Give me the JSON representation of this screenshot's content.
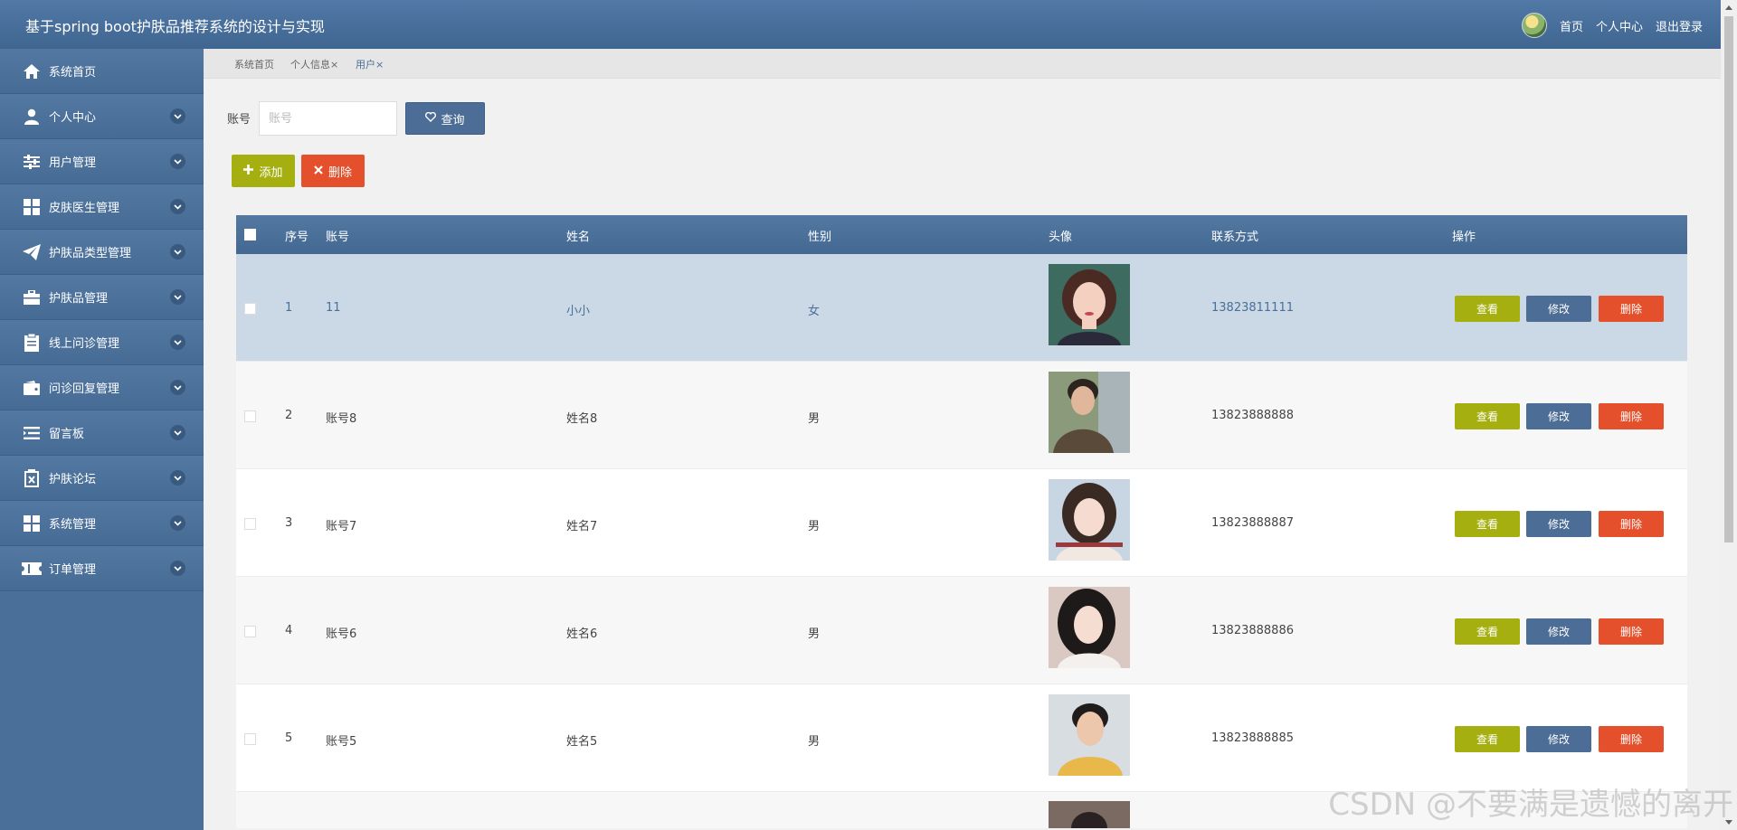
{
  "header": {
    "title": "基于spring boot护肤品推荐系统的设计与实现",
    "links": [
      "首页",
      "个人中心",
      "退出登录"
    ]
  },
  "sidebar": {
    "items": [
      {
        "label": "系统首页",
        "icon": "home-icon",
        "expandable": false
      },
      {
        "label": "个人中心",
        "icon": "user-icon",
        "expandable": true
      },
      {
        "label": "用户管理",
        "icon": "sliders-icon",
        "expandable": true
      },
      {
        "label": "皮肤医生管理",
        "icon": "grid-icon",
        "expandable": true
      },
      {
        "label": "护肤品类型管理",
        "icon": "paper-plane-icon",
        "expandable": true
      },
      {
        "label": "护肤品管理",
        "icon": "briefcase-icon",
        "expandable": true
      },
      {
        "label": "线上问诊管理",
        "icon": "clipboard-icon",
        "expandable": true
      },
      {
        "label": "问诊回复管理",
        "icon": "wallet-icon",
        "expandable": true
      },
      {
        "label": "留言板",
        "icon": "list-indent-icon",
        "expandable": true
      },
      {
        "label": "护肤论坛",
        "icon": "clipboard-x-icon",
        "expandable": true
      },
      {
        "label": "系统管理",
        "icon": "grid-icon",
        "expandable": true
      },
      {
        "label": "订单管理",
        "icon": "ticket-icon",
        "expandable": true
      }
    ]
  },
  "breadcrumb": {
    "tabs": [
      "系统首页",
      "个人信息×",
      "用户×"
    ]
  },
  "search": {
    "label": "账号",
    "placeholder": "账号",
    "button_label": "查询"
  },
  "actions": {
    "add_label": "添加",
    "delete_label": "删除"
  },
  "table": {
    "columns": [
      "序号",
      "账号",
      "姓名",
      "性别",
      "头像",
      "联系方式",
      "操作"
    ],
    "row_buttons": {
      "view": "查看",
      "edit": "修改",
      "remove": "删除"
    },
    "rows": [
      {
        "index": "1",
        "account": "11",
        "name": "小小",
        "gender": "女",
        "phone": "13823811111"
      },
      {
        "index": "2",
        "account": "账号8",
        "name": "姓名8",
        "gender": "男",
        "phone": "13823888888"
      },
      {
        "index": "3",
        "account": "账号7",
        "name": "姓名7",
        "gender": "男",
        "phone": "13823888887"
      },
      {
        "index": "4",
        "account": "账号6",
        "name": "姓名6",
        "gender": "男",
        "phone": "13823888886"
      },
      {
        "index": "5",
        "account": "账号5",
        "name": "姓名5",
        "gender": "男",
        "phone": "13823888885"
      }
    ]
  },
  "watermark": "CSDN @不要满是遗憾的离开",
  "colors": {
    "primary": "#4c6d95",
    "olive": "#a5b010",
    "danger": "#e4502b",
    "selected_row": "#cbd9e6"
  }
}
